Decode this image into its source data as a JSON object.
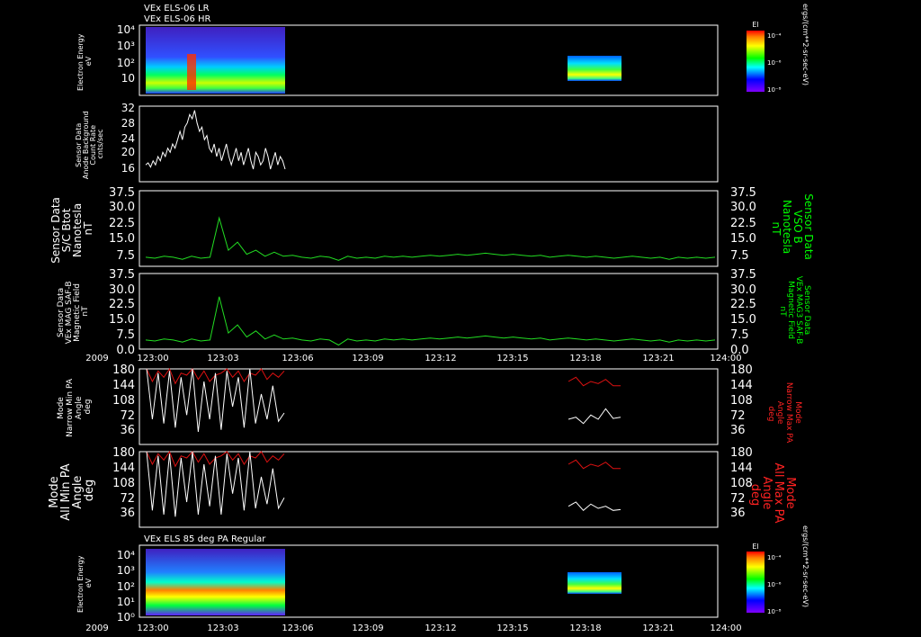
{
  "header": {
    "line1": "VEx ELS-06 LR",
    "line2": "VEx ELS-06 HR"
  },
  "colors": {
    "frame": "#ffffff",
    "white_trace": "#ffffff",
    "green_trace": "#22dd22",
    "red_trace": "#dd1111",
    "right_label_green": "#00ff00",
    "right_label_red": "#ff2222"
  },
  "time_axis": {
    "year": "2009",
    "ticks": [
      "123:00",
      "123:03",
      "123:06",
      "123:09",
      "123:12",
      "123:15",
      "123:18",
      "123:21",
      "124:00"
    ]
  },
  "chart_data": [
    {
      "type": "heatmap",
      "id": "els-lr-hr",
      "ylabel_lines": [
        "Electron Energy",
        "eV"
      ],
      "yticks": [
        "10",
        "10²",
        "10³",
        "10⁴"
      ],
      "colorbar": {
        "title": "El",
        "ticks": [
          "10⁻⁴",
          "10⁻⁶",
          "10⁻⁸"
        ],
        "unit": "ergs/(cm**2-sr-sec-eV)"
      },
      "data_intervals": [
        [
          "123:00",
          "123:06"
        ],
        [
          "123:17.5",
          "123:19.8"
        ]
      ]
    },
    {
      "type": "line",
      "id": "anode-background",
      "ylabel_lines": [
        "Sensor Data",
        "Anode Background",
        "Count Rate",
        "cnts/sec"
      ],
      "ylim": [
        14,
        32
      ],
      "yticks": [
        "16",
        "20",
        "24",
        "28",
        "32"
      ],
      "series": [
        {
          "values": [
            18,
            18.5,
            17.5,
            19,
            18,
            20,
            19,
            21,
            20,
            22,
            21,
            23,
            22,
            24,
            26,
            24,
            27,
            28,
            30,
            29,
            31,
            28,
            26,
            27,
            24,
            25,
            22,
            21,
            23,
            20,
            22,
            19,
            21,
            23,
            20,
            18,
            20,
            22,
            19,
            21,
            18,
            20,
            22,
            19,
            17,
            21,
            20,
            18,
            19,
            22,
            20,
            17,
            19,
            21,
            18,
            20,
            19,
            17
          ]
        }
      ]
    },
    {
      "type": "line",
      "id": "sc-btot",
      "ylabel_lines": [
        "Sensor Data",
        "S/C Btot",
        "Nanotesla",
        "nT"
      ],
      "right_label_lines": [
        "Sensor Data",
        "VSO B",
        "Nanotesla",
        "nT"
      ],
      "ylim": [
        0,
        37.5
      ],
      "yticks": [
        "7.5",
        "15.0",
        "22.5",
        "30.0",
        "37.5"
      ],
      "series": [
        {
          "values": [
            4.5,
            4,
            5,
            4.5,
            3.5,
            5,
            4,
            4.5,
            24,
            8,
            12,
            6,
            8,
            5,
            7,
            5,
            5.5,
            4.5,
            4,
            5,
            4.5,
            3,
            5,
            4,
            4.5,
            4,
            5,
            4.5,
            5,
            4.5,
            5,
            5.5,
            5,
            5.5,
            6,
            5.5,
            6,
            6.5,
            6,
            5.5,
            6,
            5.5,
            5,
            5.5,
            4.5,
            5,
            5.5,
            5,
            4.5,
            5,
            4.5,
            4,
            4.5,
            5,
            4.5,
            4,
            4.5,
            3.5,
            4.5,
            4,
            4.5,
            4,
            4.5
          ]
        }
      ]
    },
    {
      "type": "line",
      "id": "mag3-saf-b",
      "ylabel_lines": [
        "Sensor Data",
        "VEx MAG SAF-B",
        "Magnetic Field",
        "nT"
      ],
      "right_label_lines": [
        "Sensor Data",
        "VEx MAG3 SAF-B",
        "Magnetic Field",
        "nT"
      ],
      "ylim": [
        0,
        37.5
      ],
      "yticks": [
        "0.0",
        "7.5",
        "15.0",
        "22.5",
        "30.0",
        "37.5"
      ],
      "series": [
        {
          "values": [
            4.5,
            4,
            5,
            4.5,
            3.5,
            5,
            4,
            4.5,
            26,
            8,
            12,
            6,
            9,
            5,
            7,
            5,
            5.5,
            4.5,
            4,
            5,
            4.5,
            2,
            5,
            4,
            4.5,
            4,
            5,
            4.5,
            5,
            4.5,
            5,
            5.5,
            5,
            5.5,
            6,
            5.5,
            6,
            6.5,
            6,
            5.5,
            6,
            5.5,
            5,
            5.5,
            4.5,
            5,
            5.5,
            5,
            4.5,
            5,
            4.5,
            4,
            4.5,
            5,
            4.5,
            4,
            4.5,
            3.5,
            4.5,
            4,
            4.5,
            4,
            4.5
          ]
        }
      ]
    },
    {
      "type": "line",
      "id": "narrow-pa",
      "ylabel_lines": [
        "Mode",
        "Narrow Min PA",
        "Angle",
        "deg"
      ],
      "right_label_lines": [
        "Mode",
        "Narrow Max PA",
        "Angle",
        "deg"
      ],
      "ylim": [
        0,
        180
      ],
      "yticks": [
        "36",
        "72",
        "108",
        "144",
        "180"
      ],
      "series": [
        {
          "name": "Narrow Min PA",
          "values": [
            180,
            60,
            170,
            50,
            175,
            40,
            160,
            70,
            180,
            30,
            150,
            60,
            170,
            35,
            175,
            90,
            160,
            40,
            180,
            50,
            120,
            60,
            140,
            55,
            75,
            60,
            65,
            50,
            70,
            60,
            85,
            62,
            65
          ]
        },
        {
          "name": "Narrow Max PA",
          "values": [
            180,
            150,
            175,
            160,
            180,
            145,
            170,
            165,
            180,
            155,
            175,
            150,
            165,
            170,
            180,
            160,
            175,
            150,
            170,
            165,
            180,
            155,
            170,
            160,
            175,
            150,
            160,
            140,
            150,
            145,
            155,
            140,
            140
          ]
        }
      ]
    },
    {
      "type": "line",
      "id": "all-pa",
      "ylabel_lines": [
        "Mode",
        "All Min PA",
        "Angle",
        "deg"
      ],
      "right_label_lines": [
        "Mode",
        "All Max PA",
        "Angle",
        "deg"
      ],
      "ylim": [
        0,
        180
      ],
      "yticks": [
        "36",
        "72",
        "108",
        "144",
        "180"
      ],
      "series": [
        {
          "name": "All Min PA",
          "values": [
            180,
            40,
            170,
            30,
            175,
            25,
            165,
            60,
            180,
            30,
            150,
            50,
            170,
            30,
            175,
            80,
            165,
            40,
            180,
            45,
            120,
            55,
            140,
            45,
            70,
            50,
            60,
            40,
            55,
            45,
            50,
            40,
            42
          ]
        },
        {
          "name": "All Max PA",
          "values": [
            180,
            150,
            175,
            160,
            180,
            145,
            170,
            165,
            180,
            155,
            175,
            150,
            165,
            170,
            180,
            160,
            175,
            150,
            170,
            165,
            180,
            155,
            170,
            160,
            175,
            150,
            160,
            140,
            150,
            145,
            155,
            140,
            140
          ]
        }
      ]
    },
    {
      "type": "heatmap",
      "id": "els-85deg",
      "title": "VEx ELS 85 deg PA Regular",
      "ylabel_lines": [
        "Electron Energy",
        "eV"
      ],
      "yticks": [
        "10⁰",
        "10¹",
        "10²",
        "10³",
        "10⁴"
      ],
      "colorbar": {
        "title": "El",
        "ticks": [
          "10⁻⁴",
          "10⁻⁶",
          "10⁻⁸"
        ],
        "unit": "ergs/(cm**2-sr-sec-eV)"
      },
      "data_intervals": [
        [
          "123:00",
          "123:06"
        ],
        [
          "123:17.5",
          "123:19.8"
        ]
      ]
    }
  ]
}
